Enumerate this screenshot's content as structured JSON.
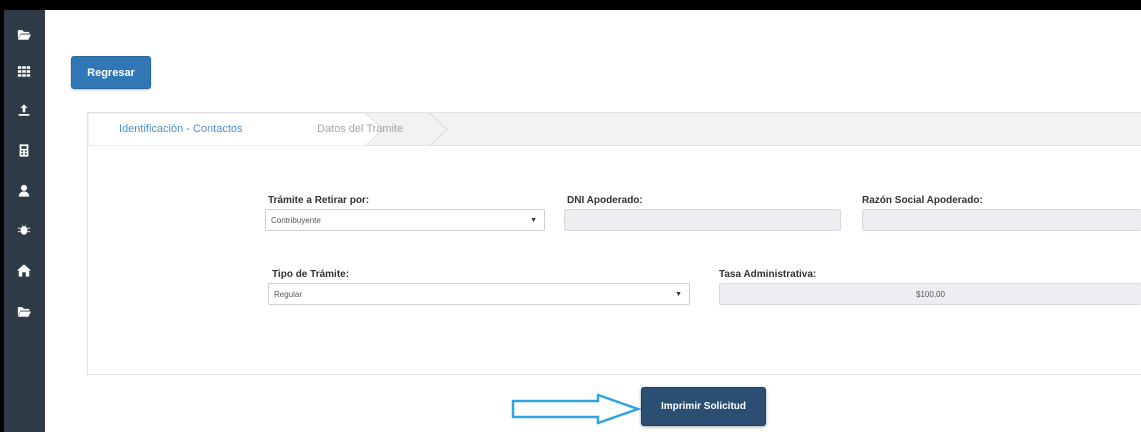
{
  "sidebar": {
    "icons": [
      "folder-open-icon",
      "grid-icon",
      "upload-icon",
      "calculator-icon",
      "user-icon",
      "bug-icon",
      "home-icon",
      "folder-icon"
    ]
  },
  "back_button": {
    "label": "Regresar"
  },
  "tabs": [
    {
      "label": "Identificación - Contactos",
      "active": true
    },
    {
      "label": "Datos del Tramite",
      "active": false
    }
  ],
  "form": {
    "retirar_por": {
      "label": "Trámite a Retirar por:",
      "value": "Contribuyente"
    },
    "dni_apoderado": {
      "label": "DNI Apoderado:",
      "value": ""
    },
    "razon_social": {
      "label": "Razón Social Apoderado:",
      "value": ""
    },
    "tipo_tramite": {
      "label": "Tipo de Trámite:",
      "value": "Regular"
    },
    "tasa": {
      "label": "Tasa Administrativa:",
      "value": "$100,00"
    }
  },
  "print_button": {
    "label": "Imprimir Solicitud"
  },
  "colors": {
    "sidebar": "#2f3a47",
    "primary": "#3176b5",
    "print": "#2a4f73",
    "arrow": "#2fa3e0"
  }
}
